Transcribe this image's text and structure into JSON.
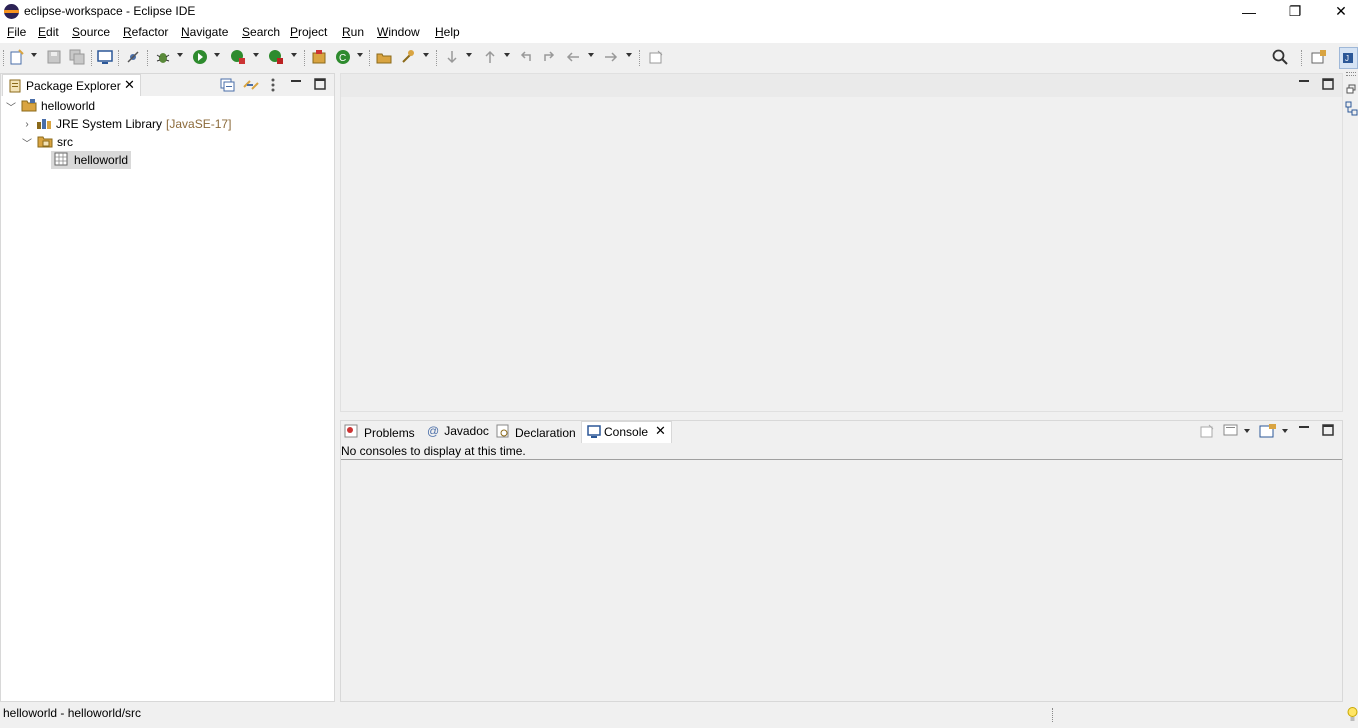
{
  "window": {
    "title": "eclipse-workspace - Eclipse IDE",
    "minimize": "—",
    "restore": "❐",
    "close": "✕"
  },
  "menu": [
    "File",
    "Edit",
    "Source",
    "Refactor",
    "Navigate",
    "Search",
    "Project",
    "Run",
    "Window",
    "Help"
  ],
  "package_explorer": {
    "tab_label": "Package Explorer",
    "tree": {
      "project": "helloworld",
      "jre_label": "JRE System Library",
      "jre_version": "[JavaSE-17]",
      "src": "src",
      "package": "helloworld"
    }
  },
  "bottom_panel": {
    "tabs": [
      "Problems",
      "Javadoc",
      "Declaration",
      "Console"
    ],
    "console_message": "No consoles to display at this time."
  },
  "status_bar": {
    "text": "helloworld - helloworld/src"
  },
  "colors": {
    "jre_version": "#8b6a3a",
    "selection": "#d9d9d9",
    "run_green": "#2e8b2e",
    "folder_tan": "#d9a441",
    "eclipse_purple": "#2c2255",
    "eclipse_orange": "#f7941e"
  }
}
